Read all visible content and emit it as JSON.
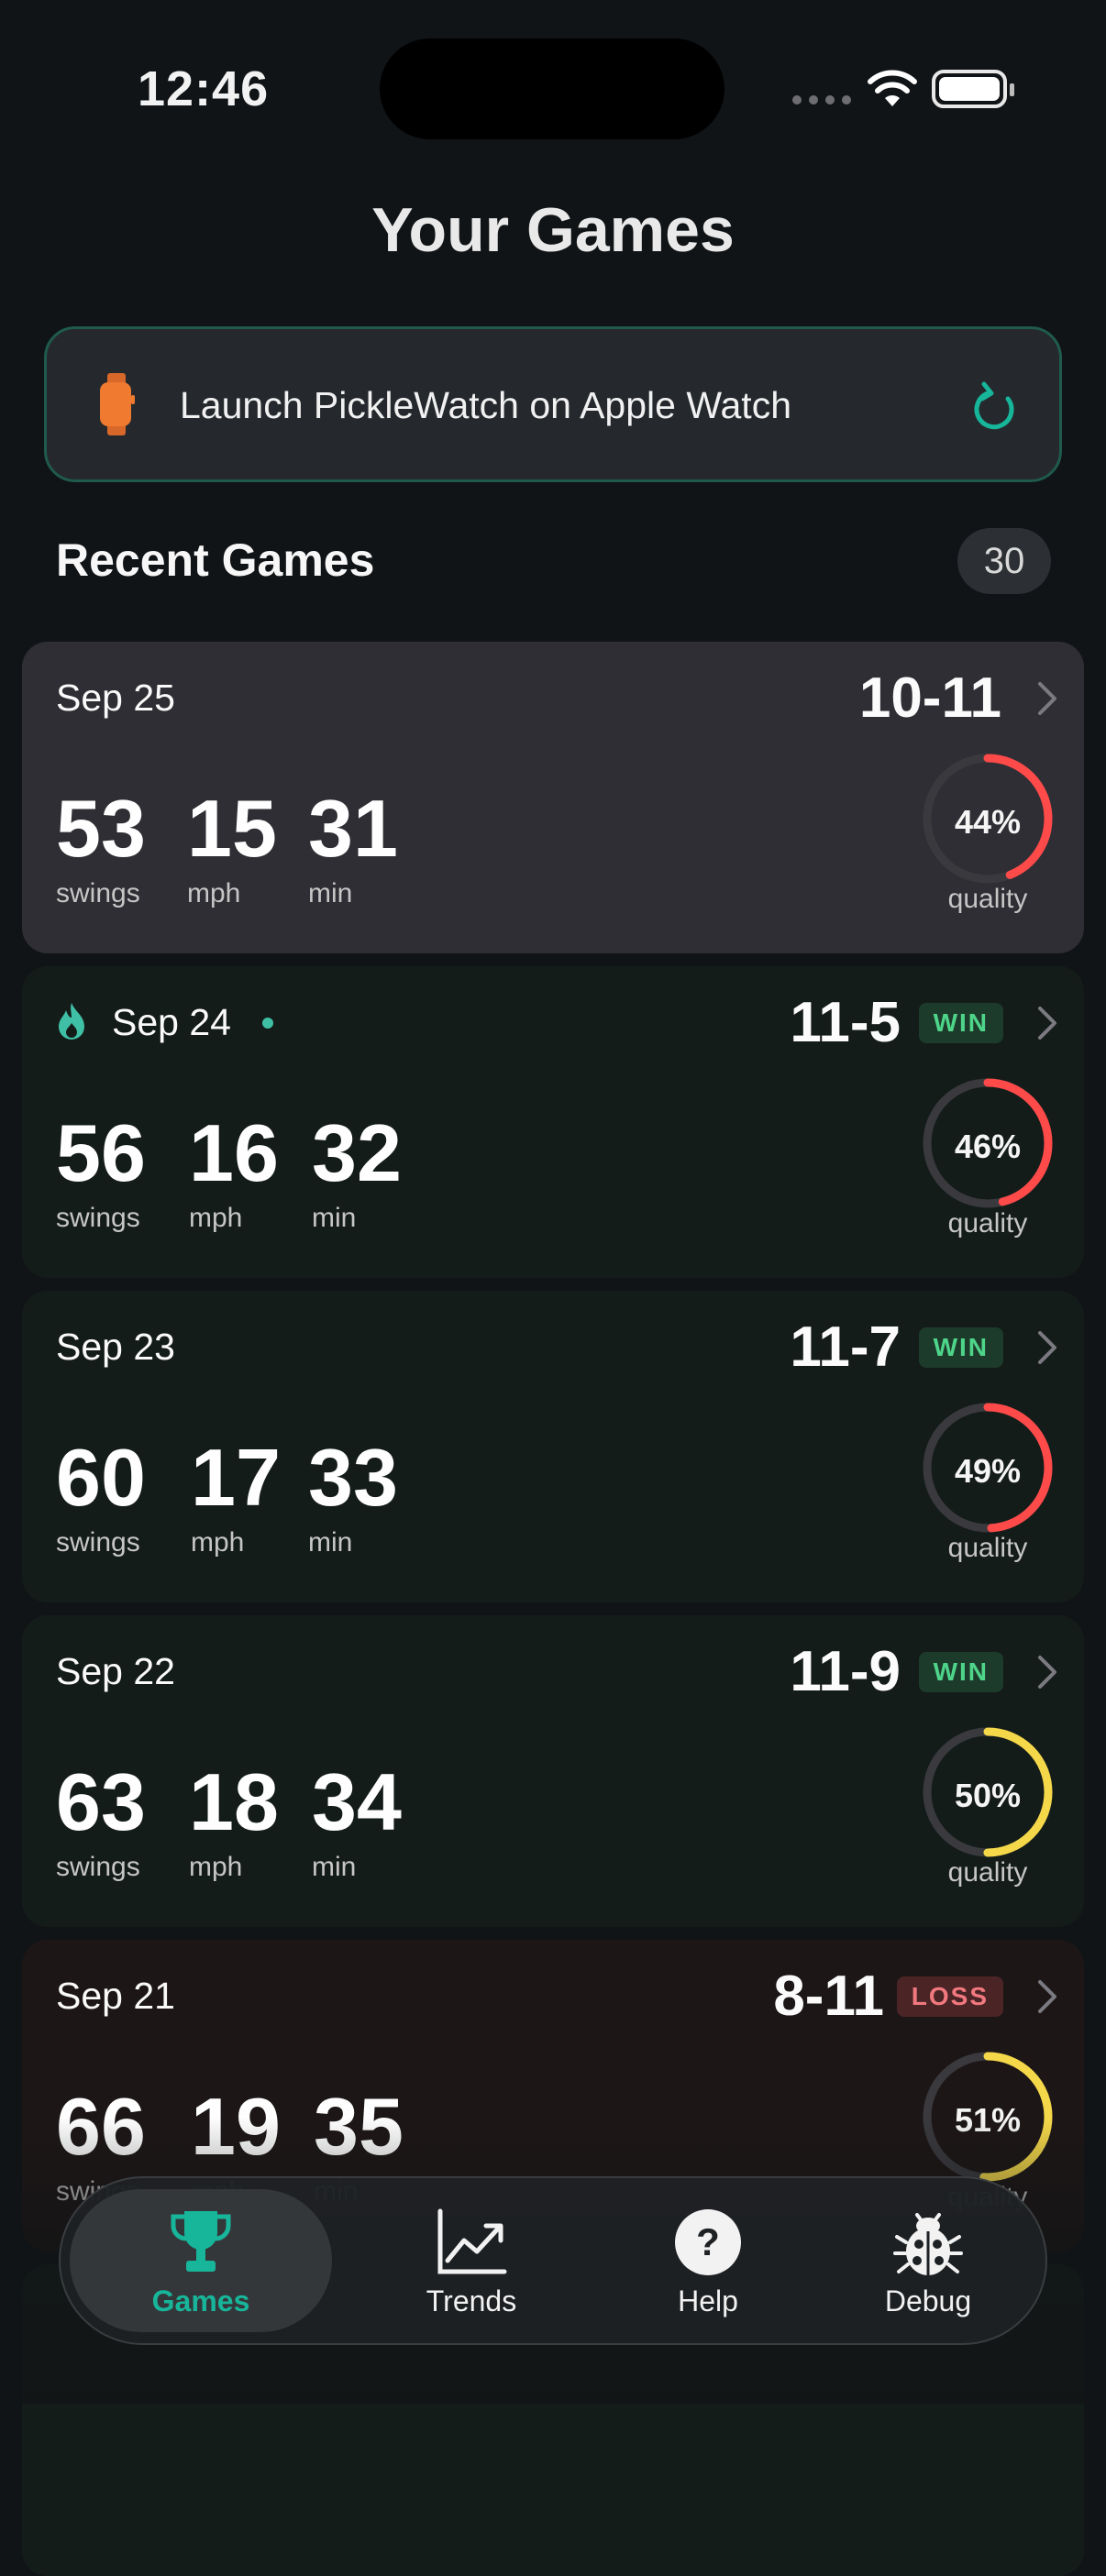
{
  "status_bar": {
    "time": "12:46"
  },
  "header": {
    "title": "Your Games"
  },
  "launch_banner": {
    "text": "Launch PickleWatch on Apple Watch",
    "icon": "apple-watch-icon",
    "action_icon": "refresh-icon",
    "accent": "#17b59a"
  },
  "recent": {
    "title": "Recent Games",
    "count": "30"
  },
  "games": [
    {
      "date": "Sep 25",
      "score": "10-11",
      "result": "",
      "swings": "53",
      "mph": "15",
      "min": "31",
      "quality": "44%",
      "quality_value": 0.44,
      "quality_color": "#ff4a4a",
      "has_flame": false
    },
    {
      "date": "Sep 24",
      "score": "11-5",
      "result": "WIN",
      "swings": "56",
      "mph": "16",
      "min": "32",
      "quality": "46%",
      "quality_value": 0.46,
      "quality_color": "#ff4a4a",
      "has_flame": true
    },
    {
      "date": "Sep 23",
      "score": "11-7",
      "result": "WIN",
      "swings": "60",
      "mph": "17",
      "min": "33",
      "quality": "49%",
      "quality_value": 0.49,
      "quality_color": "#ff4a4a",
      "has_flame": false
    },
    {
      "date": "Sep 22",
      "score": "11-9",
      "result": "WIN",
      "swings": "63",
      "mph": "18",
      "min": "34",
      "quality": "50%",
      "quality_value": 0.5,
      "quality_color": "#f5d84a",
      "has_flame": false
    },
    {
      "date": "Sep 21",
      "score": "8-11",
      "result": "LOSS",
      "swings": "66",
      "mph": "19",
      "min": "35",
      "quality": "51%",
      "quality_value": 0.51,
      "quality_color": "#f5d84a",
      "has_flame": false
    }
  ],
  "labels": {
    "swings": "swings",
    "mph": "mph",
    "min": "min",
    "quality": "quality"
  },
  "tabs": [
    {
      "label": "Games",
      "icon": "trophy-icon",
      "active": true
    },
    {
      "label": "Trends",
      "icon": "chart-trend-icon",
      "active": false
    },
    {
      "label": "Help",
      "icon": "question-icon",
      "active": false
    },
    {
      "label": "Debug",
      "icon": "bug-icon",
      "active": false
    }
  ],
  "colors": {
    "background": "#111416",
    "accent": "#17b59a",
    "win": "#4ed58a",
    "loss": "#f0787e"
  }
}
